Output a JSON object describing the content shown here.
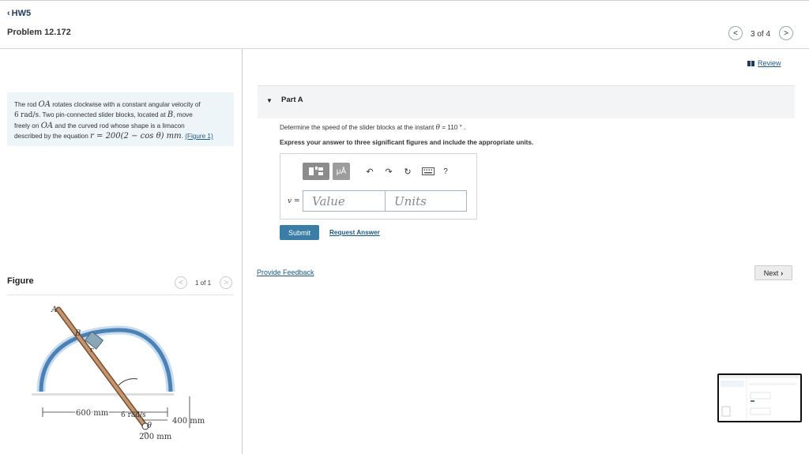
{
  "header": {
    "back_label": "HW5",
    "problem_title": "Problem 12.172",
    "page_indicator": "3 of 4"
  },
  "problem": {
    "intro_part1": "The rod ",
    "rod_symbol": "OA",
    "intro_part2": " rotates clockwise with a constant angular velocity of",
    "omega_value": "6",
    "omega_unit": "rad/s",
    "intro_part3": ". Two pin-connected slider blocks, located at ",
    "point_B": "B",
    "intro_part4": ", move",
    "intro_part5": "freely on ",
    "rod_symbol2": "OA",
    "intro_part6": " and the curved rod whose shape is a limacon",
    "intro_part7": "described by the equation ",
    "equation": "r = 200(2 − cos θ) mm",
    "intro_part8": ". ",
    "figure_link": "(Figure 1)"
  },
  "figure": {
    "label": "Figure",
    "count": "1 of 1",
    "labels": {
      "A": "A",
      "B": "B",
      "r": "r",
      "O": "O",
      "theta": "θ",
      "omega": "6 rad/s",
      "dim_400": "400 mm",
      "dim_600": "600 mm",
      "dim_200": "200 mm"
    },
    "colors": {
      "rod": "#9b6b4a",
      "curve": "#4a82b8",
      "curve_light": "#c8dcee",
      "block": "#8aa7b8"
    }
  },
  "part": {
    "title": "Part A",
    "question_prefix": "Determine the speed of the slider blocks at the instant ",
    "theta_symbol": "θ",
    "question_suffix": " = 110 ° .",
    "instruction": "Express your answer to three significant figures and include the appropriate units.",
    "variable_label": "v =",
    "value_placeholder": "Value",
    "units_placeholder": "Units",
    "toolbar_icons": [
      "templates-icon",
      "mu-a-icon",
      "undo-icon",
      "redo-icon",
      "reset-icon",
      "keyboard-icon",
      "help-icon"
    ],
    "mu_label": "μÅ",
    "help_label": "?",
    "submit_label": "Submit",
    "request_answer_label": "Request Answer"
  },
  "review_label": "Review",
  "feedback_label": "Provide Feedback",
  "next_label": "Next"
}
